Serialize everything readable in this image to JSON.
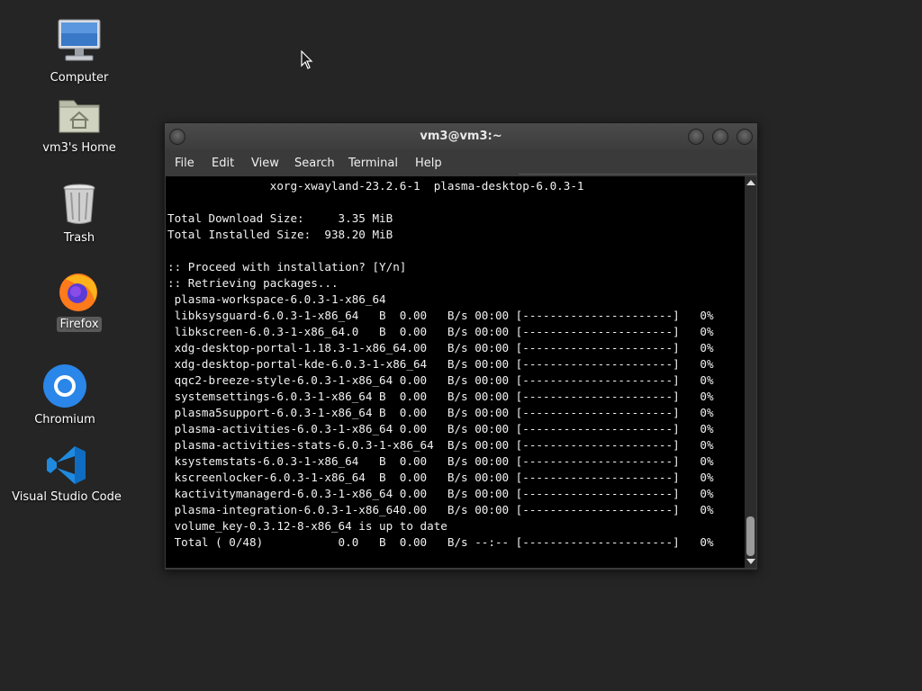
{
  "desktop": {
    "icons": [
      {
        "label": "Computer"
      },
      {
        "label": "vm3's Home"
      },
      {
        "label": "Trash"
      },
      {
        "label": "Firefox"
      },
      {
        "label": "Chromium"
      },
      {
        "label": "Visual Studio Code"
      }
    ]
  },
  "window": {
    "title": "vm3@vm3:~",
    "menu": [
      "File",
      "Edit",
      "View",
      "Search",
      "Terminal",
      "Help"
    ]
  },
  "terminal": {
    "lines": [
      "               xorg-xwayland-23.2.6-1  plasma-desktop-6.0.3-1",
      "",
      "Total Download Size:     3.35 MiB",
      "Total Installed Size:  938.20 MiB",
      "",
      ":: Proceed with installation? [Y/n]",
      ":: Retrieving packages...",
      " plasma-workspace-6.0.3-1-x86_64",
      " libksysguard-6.0.3-1-x86_64   B  0.00   B/s 00:00 [----------------------]   0%",
      " libkscreen-6.0.3-1-x86_64.0   B  0.00   B/s 00:00 [----------------------]   0%",
      " xdg-desktop-portal-1.18.3-1-x86_64.00   B/s 00:00 [----------------------]   0%",
      " xdg-desktop-portal-kde-6.0.3-1-x86_64   B/s 00:00 [----------------------]   0%",
      " qqc2-breeze-style-6.0.3-1-x86_64 0.00   B/s 00:00 [----------------------]   0%",
      " systemsettings-6.0.3-1-x86_64 B  0.00   B/s 00:00 [----------------------]   0%",
      " plasma5support-6.0.3-1-x86_64 B  0.00   B/s 00:00 [----------------------]   0%",
      " plasma-activities-6.0.3-1-x86_64 0.00   B/s 00:00 [----------------------]   0%",
      " plasma-activities-stats-6.0.3-1-x86_64  B/s 00:00 [----------------------]   0%",
      " ksystemstats-6.0.3-1-x86_64   B  0.00   B/s 00:00 [----------------------]   0%",
      " kscreenlocker-6.0.3-1-x86_64  B  0.00   B/s 00:00 [----------------------]   0%",
      " kactivitymanagerd-6.0.3-1-x86_64 0.00   B/s 00:00 [----------------------]   0%",
      " plasma-integration-6.0.3-1-x86_640.00   B/s 00:00 [----------------------]   0%",
      " volume_key-0.3.12-8-x86_64 is up to date",
      " Total ( 0/48)           0.0   B  0.00   B/s --:-- [----------------------]   0%"
    ]
  }
}
